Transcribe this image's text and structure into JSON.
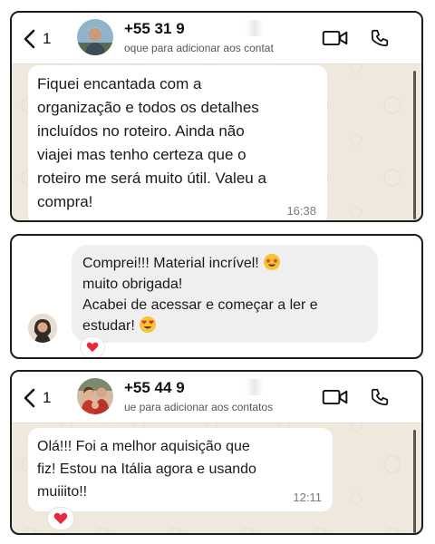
{
  "chat1": {
    "back_count": "1",
    "phone": "+55 31 9",
    "subtitle": "oque para adicionar aos contat",
    "message": "Fiquei encantada com a\norganização e todos os detalhes\nincluídos no roteiro. Ainda não\nviajei mas tenho certeza que o\nroteiro me será muito útil. Valeu a\ncompra!",
    "time": "16:38"
  },
  "chat2": {
    "message_line1": "Comprei!!! Material incrível! ",
    "message_line2": "muito obrigada!",
    "message_line3": "Acabei de acessar e começar a ler e",
    "message_line4": "estudar! ",
    "reaction": "heart"
  },
  "chat3": {
    "back_count": "1",
    "phone": "+55 44 9",
    "subtitle": "ue para adicionar aos contatos",
    "message": "Olá!!! Foi a melhor aquisição que\nfiz! Estou na Itália agora e usando\nmuiiito!!",
    "time": "12:11",
    "reaction": "heart"
  },
  "icons": {
    "back": "chevron-left-icon",
    "video": "video-camera-icon",
    "call": "phone-icon",
    "reaction": "heart-icon",
    "emoji1": "star-struck-emoji",
    "emoji2": "heart-eyes-emoji"
  },
  "colors": {
    "wallpaper": "#efe8dd",
    "bubble": "#ffffff",
    "ig_bubble": "#efefef",
    "heart": "#e8283d",
    "emoji_yellow": "#f7c531"
  }
}
